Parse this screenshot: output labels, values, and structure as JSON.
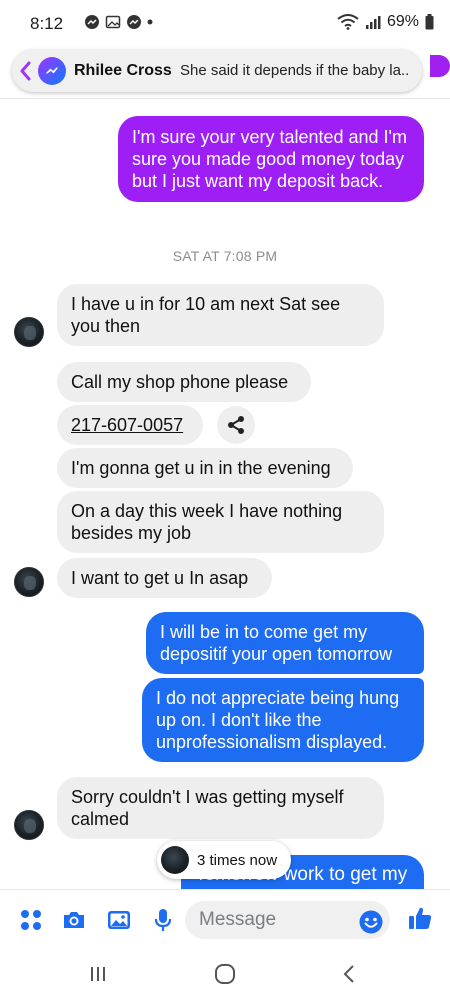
{
  "status_bar": {
    "time": "8:12",
    "battery": "69%"
  },
  "chat_head": {
    "name": "Rhilee Cross",
    "preview": "She said it depends if the baby la..."
  },
  "messages": {
    "out_1": "I'm sure your very talented and I'm sure you made good money today but I just want my deposit back.",
    "timestamp": "SAT AT 7:08 PM",
    "in_1": "I have u in for 10 am next Sat  see you then",
    "in_2": "Call my shop phone please",
    "in_3_phone": "217-607-0057",
    "in_4": "I'm gonna get u in in the evening",
    "in_5": "On a day this week I have nothing besides my job",
    "in_6": "I want to get u In asap",
    "out_2": "I will be in to come get my depositif your open tomorrow",
    "out_3": "I do not appreciate being hung up on. I don't like the unprofessionalism displayed.",
    "in_7": "Sorry couldn't I was getting myself calmed",
    "out_4_partial": "Tomorrow work to get my",
    "times_now": "3 times now"
  },
  "composer": {
    "placeholder": "Message"
  },
  "colors": {
    "purple": "#9d1ff5",
    "blue": "#1e6cf2",
    "incoming": "#eeeeee",
    "accent": "#0a7cff"
  },
  "icons": [
    "menu-dots-icon",
    "camera-icon",
    "gallery-icon",
    "mic-icon",
    "emoji-icon",
    "like-icon",
    "share-icon",
    "back-chevron-icon",
    "messenger-icon"
  ]
}
